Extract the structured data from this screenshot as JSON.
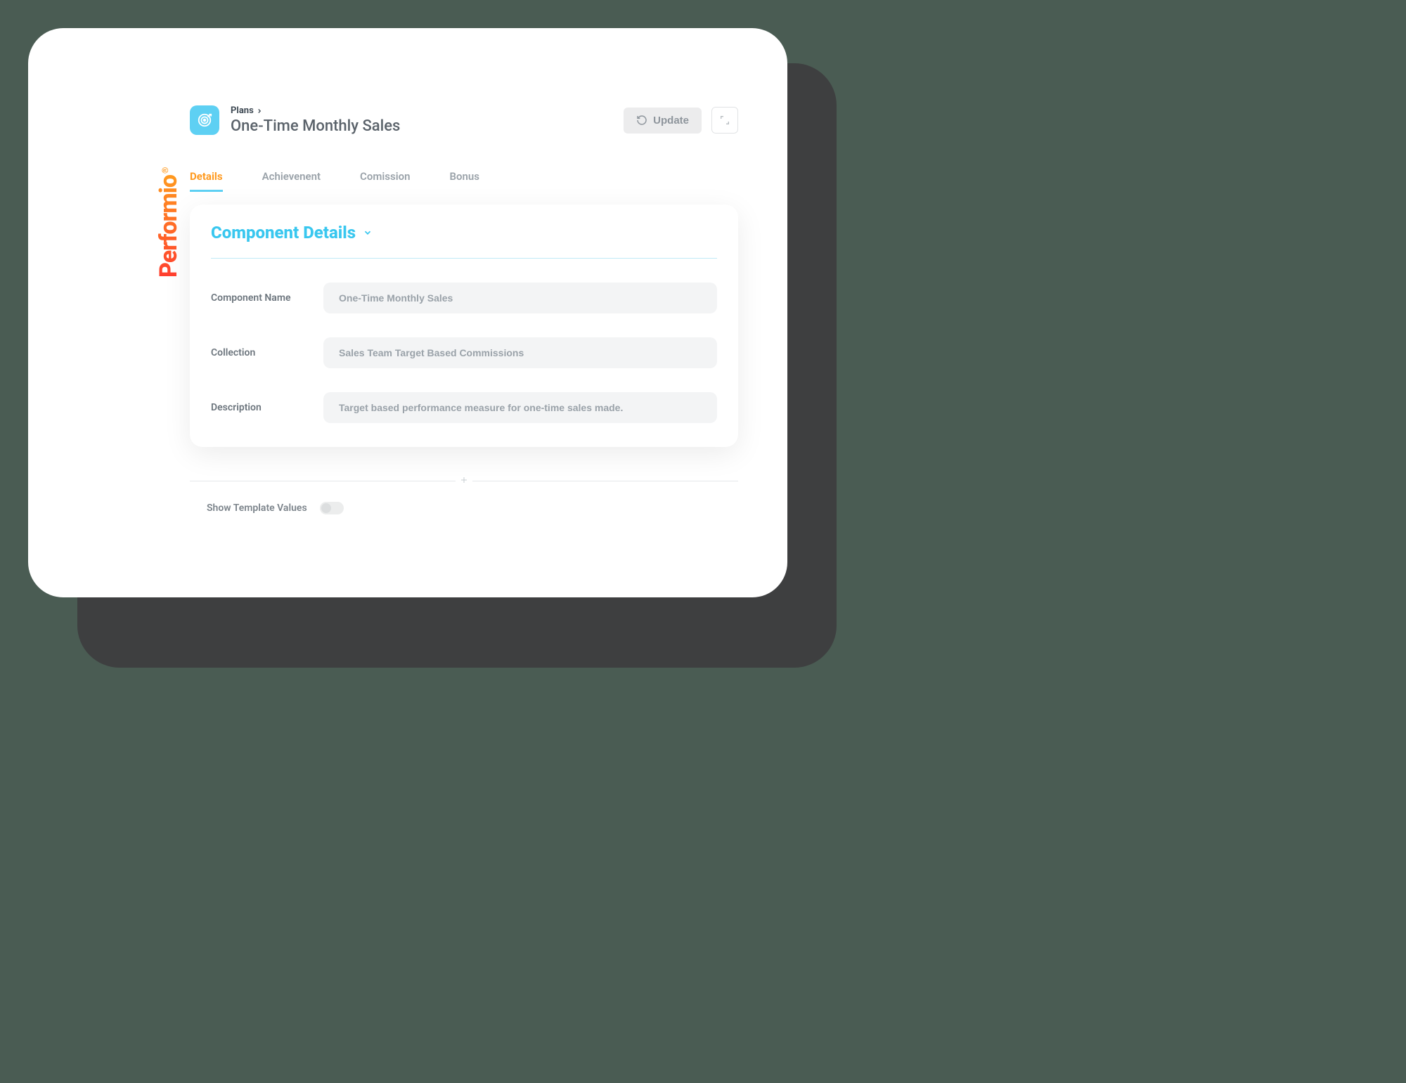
{
  "brand": "Performio",
  "breadcrumb": {
    "label": "Plans"
  },
  "page_title": "One-Time Monthly Sales",
  "header_actions": {
    "update_label": "Update"
  },
  "tabs": [
    {
      "label": "Details",
      "active": true
    },
    {
      "label": "Achievenent",
      "active": false
    },
    {
      "label": "Comission",
      "active": false
    },
    {
      "label": "Bonus",
      "active": false
    }
  ],
  "panel": {
    "title": "Component Details",
    "fields": {
      "component_name": {
        "label": "Component Name",
        "value": "One-Time Monthly Sales"
      },
      "collection": {
        "label": "Collection",
        "value": "Sales Team Target Based Commissions"
      },
      "description": {
        "label": "Description",
        "value": "Target based performance measure for one-time sales made."
      }
    }
  },
  "toggle": {
    "label": "Show Template Values",
    "value": false
  },
  "colors": {
    "accent_orange": "#ff9a1f",
    "accent_cyan": "#39c7ef",
    "bg": "#4a5c53"
  }
}
